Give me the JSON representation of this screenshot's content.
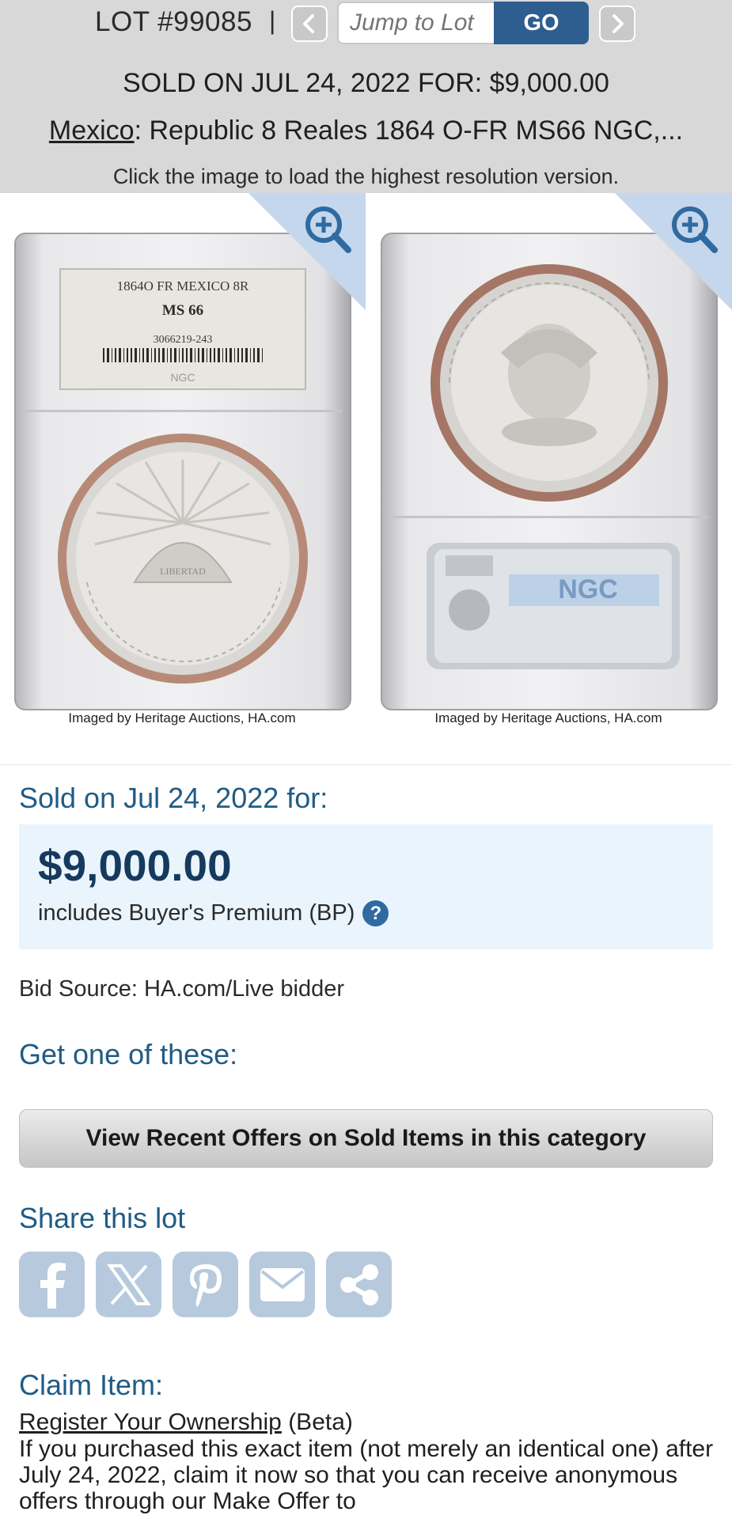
{
  "lot_nav": {
    "lot_label": "LOT #99085",
    "separator": "|",
    "jump_placeholder": "Jump to Lot",
    "go_label": "GO",
    "prev_icon": "chevron-left-icon",
    "next_icon": "chevron-right-icon"
  },
  "header": {
    "sold_line": "SOLD ON JUL 24, 2022 FOR: $9,000.00",
    "title_link": "Mexico",
    "title_rest": ": Republic 8 Reales 1864 O-FR MS66 NGC,...",
    "hint": "Click the image to load the highest resolution version."
  },
  "images": {
    "obverse": {
      "label_line1": "1864O FR MEXICO 8R",
      "label_grade": "MS 66",
      "label_cert": "3066219-243",
      "label_brand": "NGC",
      "credit": "Imaged by Heritage Auctions, HA.com"
    },
    "reverse": {
      "credit": "Imaged by Heritage Auctions, HA.com"
    },
    "zoom_icon": "zoom-in-icon"
  },
  "sale": {
    "heading": "Sold on Jul 24, 2022 for:",
    "price": "$9,000.00",
    "bp_text": "includes Buyer's Premium (BP)",
    "help_glyph": "?",
    "bid_source": "Bid Source: HA.com/Live bidder"
  },
  "get_one": {
    "heading": "Get one of these:",
    "button_label": "View Recent Offers on Sold Items in this category"
  },
  "share": {
    "heading": "Share this lot",
    "buttons": [
      "facebook-icon",
      "x-icon",
      "pinterest-icon",
      "email-icon",
      "share-icon"
    ]
  },
  "claim": {
    "heading": "Claim Item:",
    "register_link": "Register Your Ownership",
    "beta": " (Beta)",
    "body": "If you purchased this exact item (not merely an identical one) after July 24, 2022, claim it now so that you can receive anonymous offers through our Make Offer to"
  },
  "colors": {
    "header_bg": "#d8d8d8",
    "go_button": "#2e5d90",
    "heading_blue": "#1f5c86",
    "price_box_bg": "#eaf4fd",
    "share_button": "#b7c9dd",
    "zoom_corner": "#c5d7ec"
  }
}
